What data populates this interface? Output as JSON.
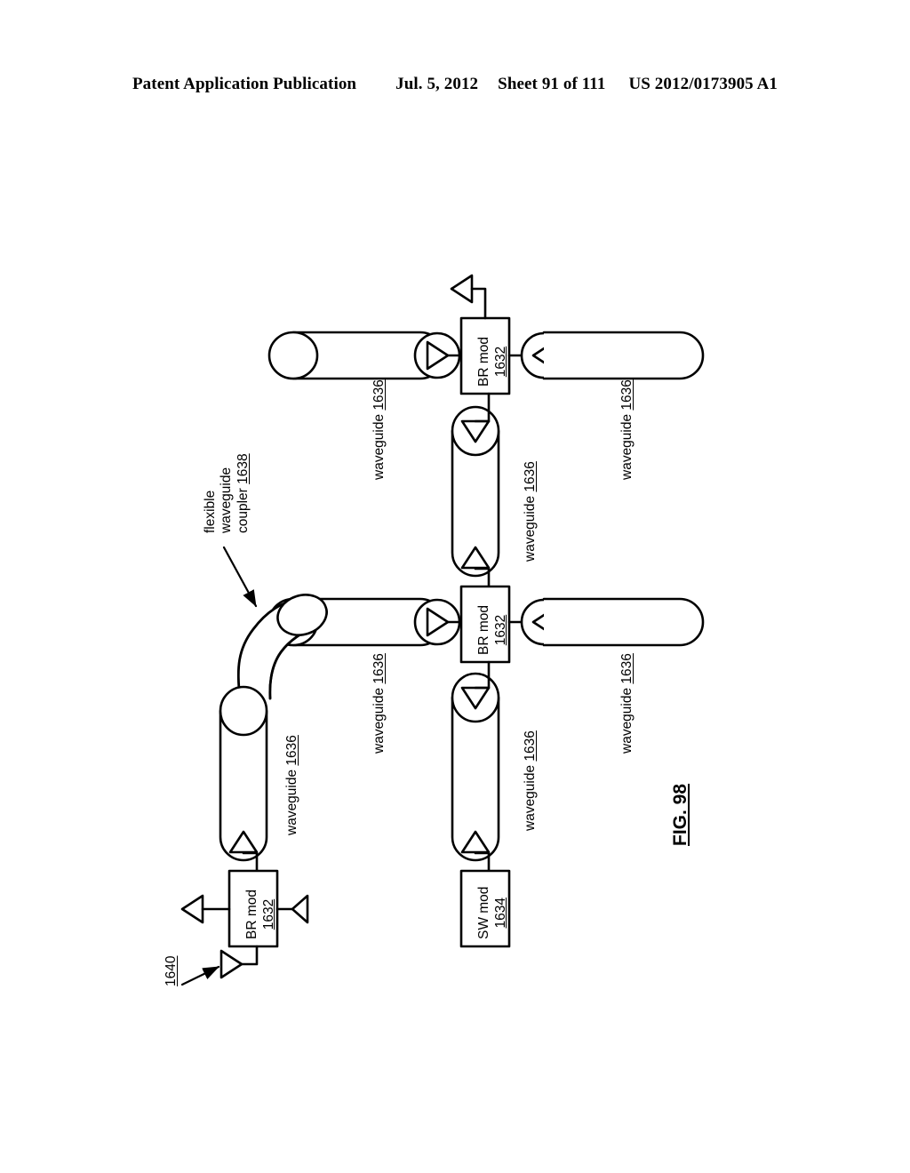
{
  "header": {
    "publication": "Patent Application Publication",
    "date": "Jul. 5, 2012",
    "sheet": "Sheet 91 of 111",
    "number": "US 2012/0173905 A1"
  },
  "figure": {
    "label": "FIG. 98",
    "assembly_ref": "1640"
  },
  "blocks": [
    {
      "id": "br-mod-top",
      "line1": "BR mod",
      "line2": "1632"
    },
    {
      "id": "br-mod-middle",
      "line1": "BR mod",
      "line2": "1632"
    },
    {
      "id": "br-mod-left",
      "line1": "BR mod",
      "line2": "1632"
    },
    {
      "id": "sw-mod",
      "line1": "SW mod",
      "line2": "1634"
    }
  ],
  "waveguides": [
    {
      "id": "wg-top-left",
      "name": "waveguide",
      "ref": "1636"
    },
    {
      "id": "wg-top-right",
      "name": "waveguide",
      "ref": "1636"
    },
    {
      "id": "wg-center-upper",
      "name": "waveguide",
      "ref": "1636"
    },
    {
      "id": "wg-middle-left",
      "name": "waveguide",
      "ref": "1636"
    },
    {
      "id": "wg-middle-right",
      "name": "waveguide",
      "ref": "1636"
    },
    {
      "id": "wg-center-lower",
      "name": "waveguide",
      "ref": "1636"
    },
    {
      "id": "wg-bottom-left",
      "name": "waveguide",
      "ref": "1636"
    }
  ],
  "coupler": {
    "line1": "flexible",
    "line2": "waveguide",
    "line3": "coupler",
    "ref": "1638"
  },
  "colors": {
    "stroke": "#000000",
    "fill": "#ffffff",
    "page": "#ffffff"
  }
}
